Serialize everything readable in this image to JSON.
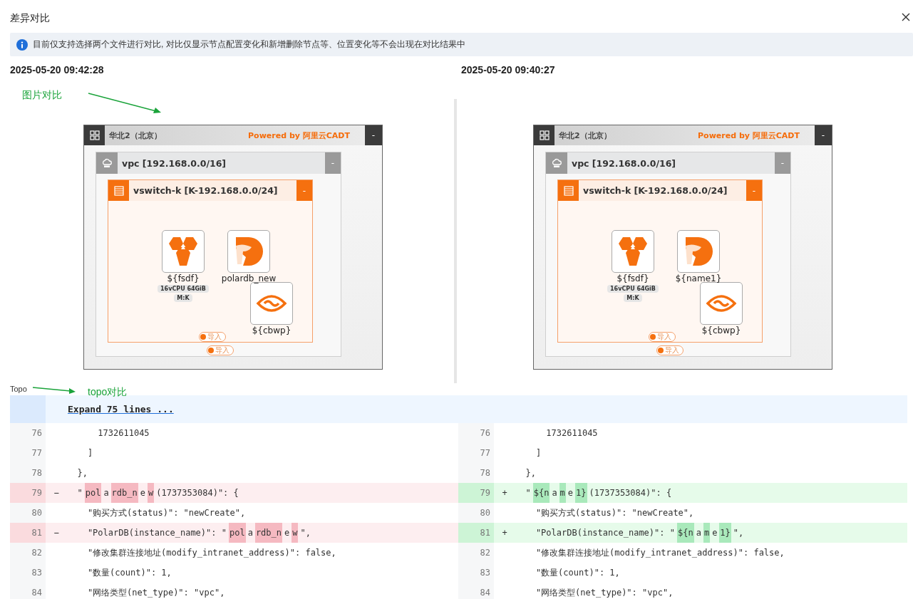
{
  "dialog": {
    "title": "差异对比"
  },
  "notice": "目前仅支持选择两个文件进行对比, 对比仅显示节点配置变化和新增删除节点等、位置变化等不会出现在对比结果中",
  "versions": [
    {
      "timestamp": "2025-05-20 09:42:28",
      "topology": {
        "region": "华北2（北京）",
        "powered_by": "Powered by 阿里云CADT",
        "region_button": "-",
        "vpc": "vpc [192.168.0.0/16]",
        "vpc_button": "-",
        "vswitch": "vswitch-k [K-192.168.0.0/24]",
        "vswitch_button": "-",
        "nodes": [
          {
            "kind": "ecs",
            "name": "${fsdf}",
            "specs": [
              "16vCPU 64GiB",
              "M:K"
            ]
          },
          {
            "kind": "polardb",
            "name": "polardb_new"
          },
          {
            "kind": "cbwp",
            "name": "${cbwp}"
          }
        ],
        "vswitch_badge": "导入",
        "vpc_badge": "导入"
      }
    },
    {
      "timestamp": "2025-05-20 09:40:27",
      "topology": {
        "region": "华北2（北京）",
        "powered_by": "Powered by 阿里云CADT",
        "region_button": "-",
        "vpc": "vpc [192.168.0.0/16]",
        "vpc_button": "-",
        "vswitch": "vswitch-k [K-192.168.0.0/24]",
        "vswitch_button": "-",
        "nodes": [
          {
            "kind": "ecs",
            "name": "${fsdf}",
            "specs": [
              "16vCPU 64GiB",
              "M:K"
            ]
          },
          {
            "kind": "polardb",
            "name": "${name1}"
          },
          {
            "kind": "cbwp",
            "name": "${cbwp}"
          }
        ],
        "vswitch_badge": "导入",
        "vpc_badge": "导入"
      }
    }
  ],
  "annotations": [
    {
      "text": "图片对比"
    },
    {
      "text": "topo对比"
    }
  ],
  "section_label": "Topo",
  "diff": {
    "expand": "Expand 75 lines ...",
    "rows": [
      {
        "left": {
          "num": "76",
          "kind": "context",
          "segments": [
            {
              "text": "      1732611045",
              "changed": false
            }
          ]
        },
        "right": {
          "num": "76",
          "kind": "context",
          "segments": [
            {
              "text": "      1732611045",
              "changed": false
            }
          ]
        }
      },
      {
        "left": {
          "num": "77",
          "kind": "context",
          "segments": [
            {
              "text": "    ]",
              "changed": false
            }
          ]
        },
        "right": {
          "num": "77",
          "kind": "context",
          "segments": [
            {
              "text": "    ]",
              "changed": false
            }
          ]
        }
      },
      {
        "left": {
          "num": "78",
          "kind": "context",
          "segments": [
            {
              "text": "  },",
              "changed": false
            }
          ]
        },
        "right": {
          "num": "78",
          "kind": "context",
          "segments": [
            {
              "text": "  },",
              "changed": false
            }
          ]
        }
      },
      {
        "left": {
          "num": "79",
          "kind": "removed",
          "sign": "−",
          "segments": [
            {
              "text": "  \"",
              "changed": false
            },
            {
              "text": "pol",
              "changed": true
            },
            {
              "text": "a",
              "changed": false
            },
            {
              "text": "rdb_n",
              "changed": true
            },
            {
              "text": "e",
              "changed": false
            },
            {
              "text": "w",
              "changed": true
            },
            {
              "text": "(1737353084)\": {",
              "changed": false
            }
          ]
        },
        "right": {
          "num": "79",
          "kind": "added",
          "sign": "+",
          "segments": [
            {
              "text": "  \"",
              "changed": false
            },
            {
              "text": "${n",
              "changed": true
            },
            {
              "text": "a",
              "changed": false
            },
            {
              "text": "m",
              "changed": true
            },
            {
              "text": "e",
              "changed": false
            },
            {
              "text": "1}",
              "changed": true
            },
            {
              "text": "(1737353084)\": {",
              "changed": false
            }
          ]
        }
      },
      {
        "left": {
          "num": "80",
          "kind": "context",
          "segments": [
            {
              "text": "    \"购买方式(status)\": \"newCreate\",",
              "changed": false
            }
          ]
        },
        "right": {
          "num": "80",
          "kind": "context",
          "segments": [
            {
              "text": "    \"购买方式(status)\": \"newCreate\",",
              "changed": false
            }
          ]
        }
      },
      {
        "left": {
          "num": "81",
          "kind": "removed",
          "sign": "−",
          "segments": [
            {
              "text": "    \"PolarDB(instance_name)\": \"",
              "changed": false
            },
            {
              "text": "pol",
              "changed": true
            },
            {
              "text": "a",
              "changed": false
            },
            {
              "text": "rdb_n",
              "changed": true
            },
            {
              "text": "e",
              "changed": false
            },
            {
              "text": "w",
              "changed": true
            },
            {
              "text": "\",",
              "changed": false
            }
          ]
        },
        "right": {
          "num": "81",
          "kind": "added",
          "sign": "+",
          "segments": [
            {
              "text": "    \"PolarDB(instance_name)\": \"",
              "changed": false
            },
            {
              "text": "${n",
              "changed": true
            },
            {
              "text": "a",
              "changed": false
            },
            {
              "text": "m",
              "changed": true
            },
            {
              "text": "e",
              "changed": false
            },
            {
              "text": "1}",
              "changed": true
            },
            {
              "text": "\",",
              "changed": false
            }
          ]
        }
      },
      {
        "left": {
          "num": "82",
          "kind": "context",
          "segments": [
            {
              "text": "    \"修改集群连接地址(modify_intranet_address)\": false,",
              "changed": false
            }
          ]
        },
        "right": {
          "num": "82",
          "kind": "context",
          "segments": [
            {
              "text": "    \"修改集群连接地址(modify_intranet_address)\": false,",
              "changed": false
            }
          ]
        }
      },
      {
        "left": {
          "num": "83",
          "kind": "context",
          "segments": [
            {
              "text": "    \"数量(count)\": 1,",
              "changed": false
            }
          ]
        },
        "right": {
          "num": "83",
          "kind": "context",
          "segments": [
            {
              "text": "    \"数量(count)\": 1,",
              "changed": false
            }
          ]
        }
      },
      {
        "left": {
          "num": "84",
          "kind": "context",
          "segments": [
            {
              "text": "    \"网络类型(net_type)\": \"vpc\",",
              "changed": false
            }
          ]
        },
        "right": {
          "num": "84",
          "kind": "context",
          "segments": [
            {
              "text": "    \"网络类型(net_type)\": \"vpc\",",
              "changed": false
            }
          ]
        }
      }
    ]
  }
}
